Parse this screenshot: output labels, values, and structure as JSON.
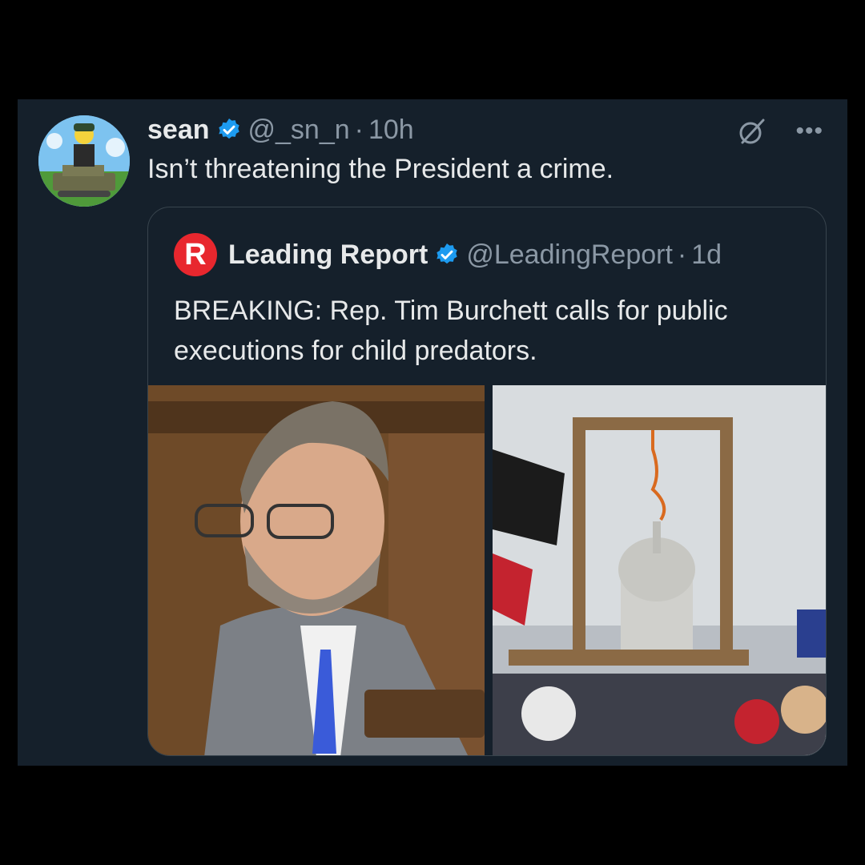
{
  "tweet": {
    "author_name": "sean",
    "handle": "@_sn_n",
    "separator": "·",
    "time": "10h",
    "text": "Isn’t threatening the President a crime.",
    "icons": [
      "grok-icon",
      "more-icon"
    ],
    "more_label": "•••"
  },
  "quoted": {
    "logo_letter": "R",
    "author_name": "Leading Report",
    "handle": "@LeadingReport",
    "separator": "·",
    "time": "1d",
    "text": "BREAKING: Rep. Tim Burchett calls for public executions for child predators."
  },
  "colors": {
    "background": "#000000",
    "card": "#15202b",
    "border": "#38444d",
    "verified": "#1d9bf0",
    "muted": "#8b98a5",
    "logo_red": "#e8272e"
  }
}
